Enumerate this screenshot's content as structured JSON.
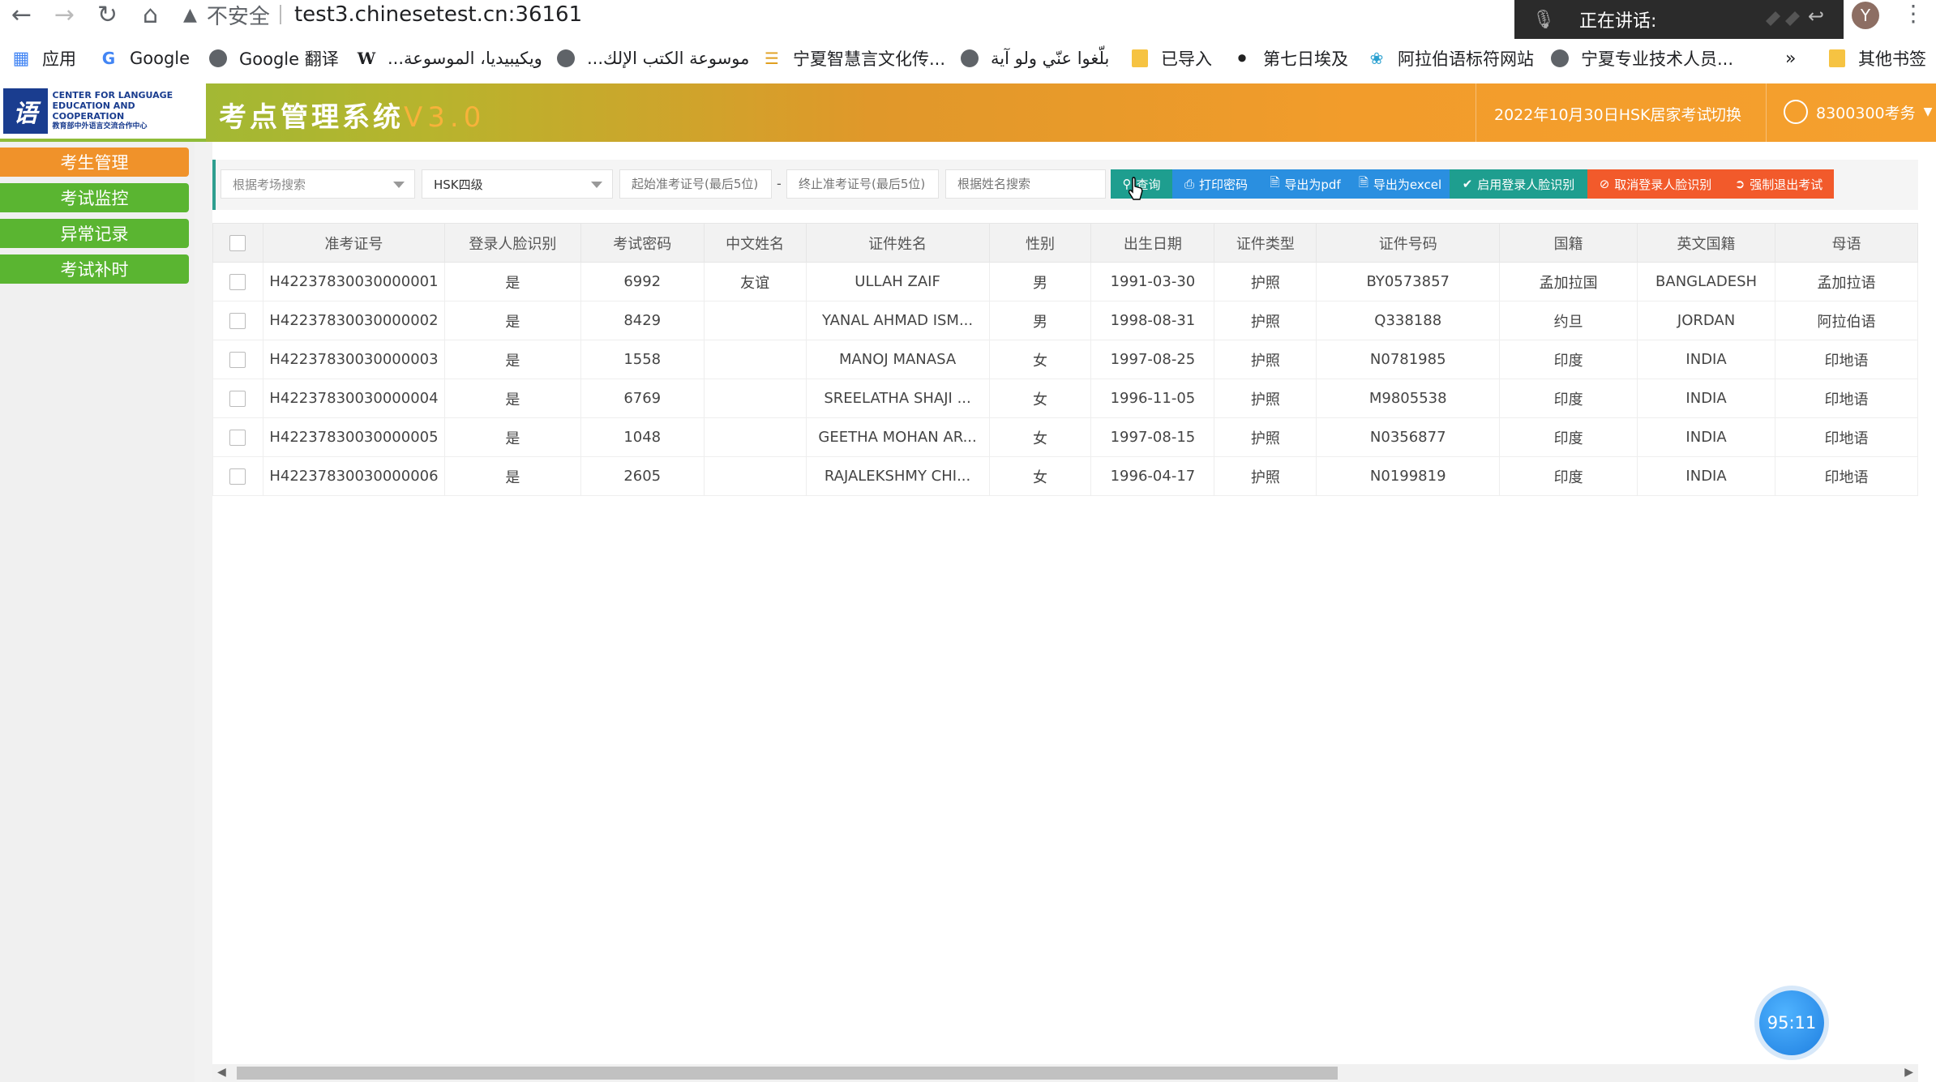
{
  "browser": {
    "url": "test3.chinesetest.cn:36161",
    "security_label": "不安全",
    "speaking_label": "正在讲话:",
    "profile_initial": "Y",
    "bookmarks": [
      {
        "label": "应用",
        "icon": "apps-icon"
      },
      {
        "label": "Google",
        "icon": "google-icon"
      },
      {
        "label": "Google 翻译",
        "icon": "globe-icon"
      },
      {
        "label": "...ويكيبيديا، الموسوعة",
        "icon": "wikipedia-icon"
      },
      {
        "label": "...موسوعة الكتب الإلك",
        "icon": "globe-icon"
      },
      {
        "label": "宁夏智慧言文化传...",
        "icon": "site-icon"
      },
      {
        "label": "بلّغوا عنّي ولو آية",
        "icon": "globe-icon"
      },
      {
        "label": "已导入",
        "icon": "folder-icon"
      },
      {
        "label": "第七日埃及",
        "icon": "site-icon"
      },
      {
        "label": "阿拉伯语标符网站",
        "icon": "site-icon"
      },
      {
        "label": "宁夏专业技术人员...",
        "icon": "globe-icon"
      },
      {
        "label": "»",
        "icon": ""
      },
      {
        "label": "其他书签",
        "icon": "folder-icon"
      }
    ]
  },
  "header": {
    "logo_text_1": "CENTER FOR LANGUAGE",
    "logo_text_2": "EDUCATION AND COOPERATION",
    "logo_text_3": "教育部中外语言交流合作中心",
    "title": "考点管理系统",
    "version": "V3.0",
    "exam_name": "2022年10月30日HSK居家考试",
    "switch_label": "切换",
    "user_name": "8300300考务"
  },
  "sidebar": {
    "items": [
      {
        "label": "考生管理",
        "color": "#f0922a"
      },
      {
        "label": "考试监控",
        "color": "#5ab531"
      },
      {
        "label": "异常记录",
        "color": "#5ab531"
      },
      {
        "label": "考试补时",
        "color": "#5ab531"
      }
    ]
  },
  "toolbar": {
    "room_placeholder": "根据考场搜索",
    "level_value": "HSK四级",
    "start_placeholder": "起始准考证号(最后5位)",
    "end_placeholder": "终止准考证号(最后5位)",
    "name_placeholder": "根据姓名搜索",
    "dash": "-",
    "buttons": [
      {
        "label": "查询",
        "color": "#1e9e8f"
      },
      {
        "label": "打印密码",
        "color": "#2a8fe0"
      },
      {
        "label": "导出为pdf",
        "color": "#2a8fe0"
      },
      {
        "label": "导出为excel",
        "color": "#2a8fe0"
      },
      {
        "label": "启用登录人脸识别",
        "color": "#1e9e8f"
      },
      {
        "label": "取消登录人脸识别",
        "color": "#f25a2b"
      },
      {
        "label": "强制退出考试",
        "color": "#f25a2b"
      }
    ]
  },
  "table": {
    "columns": [
      "准考证号",
      "登录人脸识别",
      "考试密码",
      "中文姓名",
      "证件姓名",
      "性别",
      "出生日期",
      "证件类型",
      "证件号码",
      "国籍",
      "英文国籍",
      "母语"
    ],
    "rows": [
      [
        "H42237830030000001",
        "是",
        "6992",
        "友谊",
        "ULLAH ZAIF",
        "男",
        "1991-03-30",
        "护照",
        "BY0573857",
        "孟加拉国",
        "BANGLADESH",
        "孟加拉语"
      ],
      [
        "H42237830030000002",
        "是",
        "8429",
        "",
        "YANAL AHMAD ISM...",
        "男",
        "1998-08-31",
        "护照",
        "Q338188",
        "约旦",
        "JORDAN",
        "阿拉伯语"
      ],
      [
        "H42237830030000003",
        "是",
        "1558",
        "",
        "MANOJ MANASA",
        "女",
        "1997-08-25",
        "护照",
        "N0781985",
        "印度",
        "INDIA",
        "印地语"
      ],
      [
        "H42237830030000004",
        "是",
        "6769",
        "",
        "SREELATHA SHAJI ...",
        "女",
        "1996-11-05",
        "护照",
        "M9805538",
        "印度",
        "INDIA",
        "印地语"
      ],
      [
        "H42237830030000005",
        "是",
        "1048",
        "",
        "GEETHA MOHAN AR...",
        "女",
        "1997-08-15",
        "护照",
        "N0356877",
        "印度",
        "INDIA",
        "印地语"
      ],
      [
        "H42237830030000006",
        "是",
        "2605",
        "",
        "RAJALEKSHMY CHI...",
        "女",
        "1996-04-17",
        "护照",
        "N0199819",
        "印度",
        "INDIA",
        "印地语"
      ]
    ]
  },
  "timer": "95:11"
}
